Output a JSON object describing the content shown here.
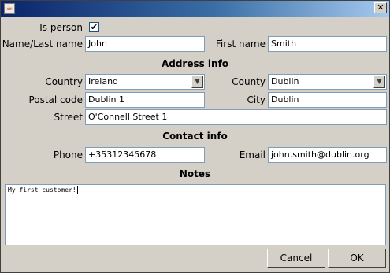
{
  "window": {
    "close_glyph": "✕",
    "app_icon": "java-icon"
  },
  "person": {
    "is_person_label": "Is person",
    "is_person_checked": true,
    "check_glyph": "✔"
  },
  "name": {
    "last_label": "Name/Last name",
    "last_value": "John",
    "first_label": "First name",
    "first_value": "Smith"
  },
  "address": {
    "section_title": "Address info",
    "country_label": "Country",
    "country_value": "Ireland",
    "county_label": "County",
    "county_value": "Dublin",
    "postal_label": "Postal code",
    "postal_value": "Dublin 1",
    "city_label": "City",
    "city_value": "Dublin",
    "street_label": "Street",
    "street_value": "O'Connell Street 1",
    "dropdown_glyph": "▼"
  },
  "contact": {
    "section_title": "Contact info",
    "phone_label": "Phone",
    "phone_value": "+35312345678",
    "email_label": "Email",
    "email_value": "john.smith@dublin.org"
  },
  "notes": {
    "section_title": "Notes",
    "value": "My first customer!"
  },
  "buttons": {
    "cancel": "Cancel",
    "ok": "OK"
  }
}
